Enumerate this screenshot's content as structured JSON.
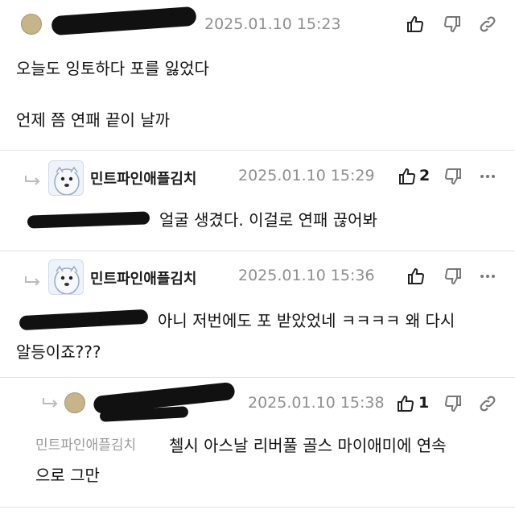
{
  "comments": [
    {
      "author": "",
      "date": "2025.01.10 15:23",
      "likes": "",
      "lines": [
        "오늘도 잉토하다 포를 잃었다",
        "",
        "언제 쯤 연패 끝이 날까"
      ]
    },
    {
      "author": "민트파인애플김치",
      "date": "2025.01.10 15:29",
      "likes": "2",
      "text": "얼굴 생겼다. 이걸로 연패 끊어봐"
    },
    {
      "author": "민트파인애플김치",
      "date": "2025.01.10 15:36",
      "likes": "",
      "text_line1": "아니 저번에도 포 받았었네 ㅋㅋㅋㅋ 왜 다시",
      "text_line2": "알등이죠???"
    },
    {
      "author": "",
      "date": "2025.01.10 15:38",
      "likes": "1",
      "mention": "민트파인애플김치",
      "text_line1": "첼시 아스날 리버풀 골스 마이애미에 연속",
      "text_line2": "으로 그만"
    }
  ],
  "icons": {
    "like": "thumbs-up-icon",
    "dislike": "thumbs-down-icon",
    "link": "link-icon",
    "more": "more-icon",
    "reply": "reply-arrow-icon"
  },
  "colors": {
    "date": "#8f8f8f",
    "divider": "#e3e3e3",
    "mention": "#9a9a9a"
  }
}
